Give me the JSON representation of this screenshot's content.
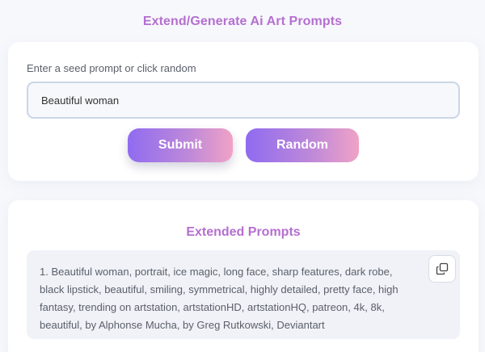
{
  "header": {
    "title": "Extend/Generate Ai Art Prompts"
  },
  "seed": {
    "label": "Enter a seed prompt or click random",
    "value": "Beautiful woman",
    "placeholder": ""
  },
  "buttons": {
    "submit": "Submit",
    "random": "Random"
  },
  "results": {
    "title": "Extended Prompts",
    "items": [
      "1. Beautiful woman, portrait, ice magic, long face, sharp features, dark robe, black lipstick, beautiful, smiling, symmetrical, highly detailed, pretty face, high fantasy, trending on artstation, artstationHD, artstationHQ, patreon, 4k, 8k, beautiful, by Alphonse Mucha, by Greg Rutkowski, Deviantart"
    ],
    "copy_icon": "copy-icon"
  },
  "colors": {
    "title": "#b56fd0",
    "button_gradient_start": "#8f6bf0",
    "button_gradient_end": "#f0a2c6",
    "background": "#f7f8fc"
  }
}
